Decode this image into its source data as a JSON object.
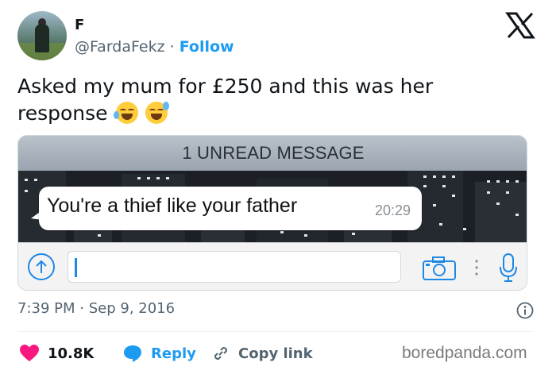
{
  "author": {
    "display_name": "F",
    "handle": "@FardaFekz",
    "separator": "·",
    "follow_label": "Follow"
  },
  "tweet": {
    "text": "Asked my mum for £250 and this was her response",
    "emojis": [
      "face-with-tears-of-joy-icon",
      "grinning-face-with-sweat-icon"
    ]
  },
  "image": {
    "unread_banner": "1 UNREAD MESSAGE",
    "message_text": "You're a thief like your father",
    "message_time": "20:29"
  },
  "meta": {
    "time": "7:39 PM",
    "separator": "·",
    "date": "Sep 9, 2016"
  },
  "actions": {
    "likes": "10.8K",
    "reply_label": "Reply",
    "copy_label": "Copy link"
  },
  "watermark": "boredpanda.com",
  "colors": {
    "accent": "#1d9bf0",
    "like": "#f91880",
    "text": "#0f1419",
    "secondary": "#536471"
  }
}
